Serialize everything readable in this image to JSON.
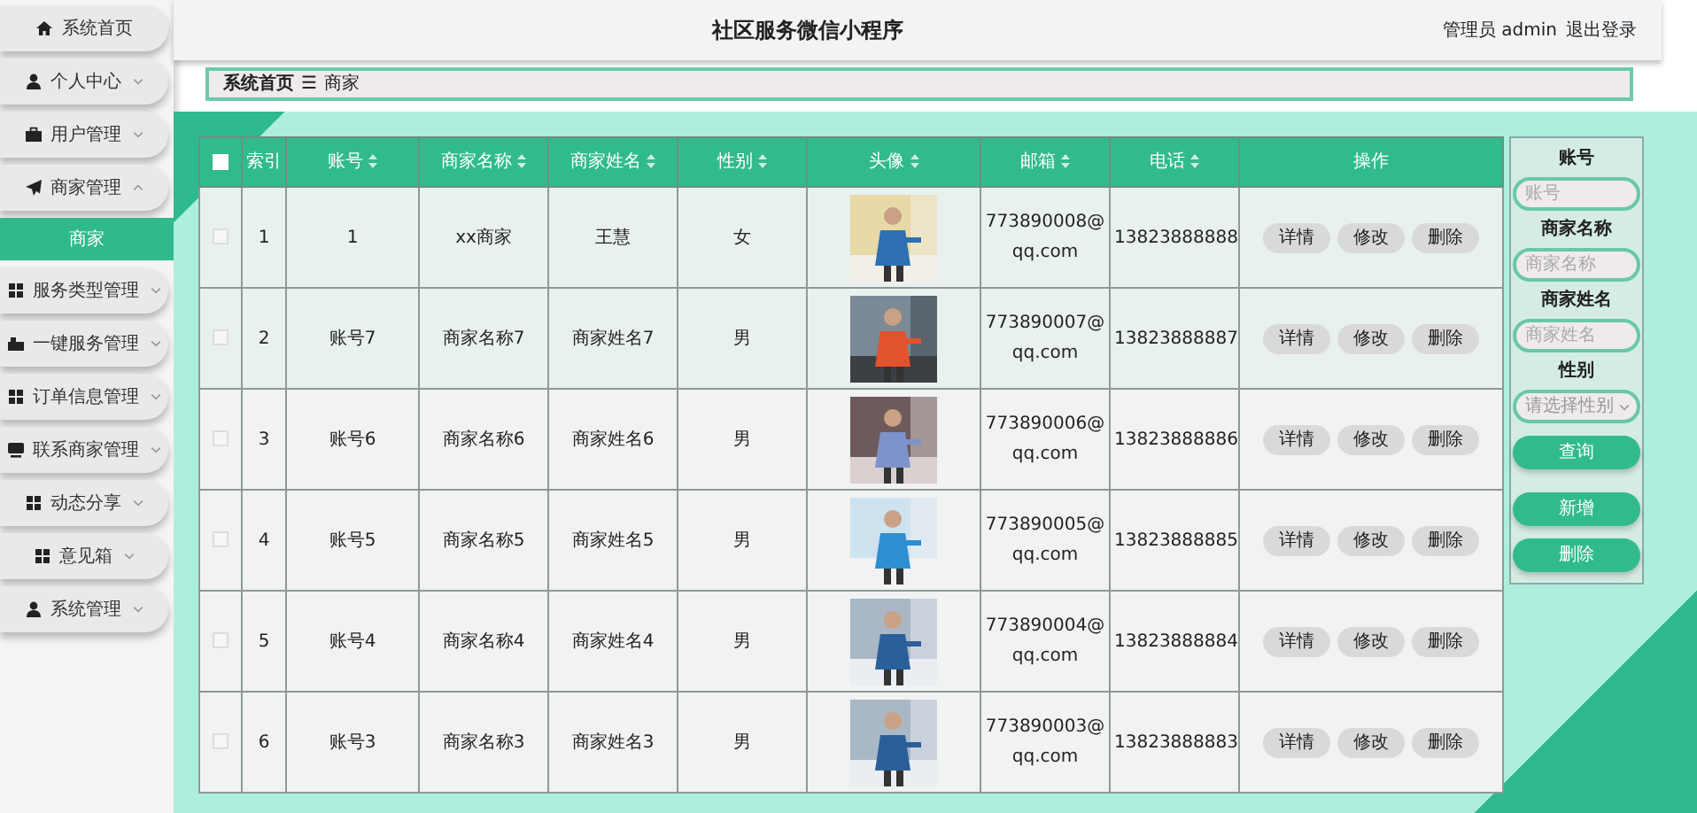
{
  "header": {
    "title": "社区服务微信小程序",
    "user_label": "管理员 admin",
    "logout": "退出登录"
  },
  "sidebar": {
    "items": [
      {
        "label": "系统首页"
      },
      {
        "label": "个人中心",
        "expanded": false
      },
      {
        "label": "用户管理",
        "expanded": false
      },
      {
        "label": "商家管理",
        "expanded": true,
        "children": [
          {
            "label": "商家",
            "selected": true
          }
        ]
      },
      {
        "label": "服务类型管理",
        "expanded": false
      },
      {
        "label": "一键服务管理",
        "expanded": false
      },
      {
        "label": "订单信息管理",
        "expanded": false
      },
      {
        "label": "联系商家管理",
        "expanded": false
      },
      {
        "label": "动态分享",
        "expanded": false
      },
      {
        "label": "意见箱",
        "expanded": false
      },
      {
        "label": "系统管理",
        "expanded": false
      }
    ]
  },
  "breadcrumb": {
    "items": [
      "系统首页",
      "商家"
    ],
    "separator": "☰"
  },
  "table": {
    "select_all": {
      "checked": false
    },
    "columns": [
      {
        "label": "索引",
        "sortable": false
      },
      {
        "label": "账号",
        "sortable": true
      },
      {
        "label": "商家名称",
        "sortable": true
      },
      {
        "label": "商家姓名",
        "sortable": true
      },
      {
        "label": "性别",
        "sortable": true
      },
      {
        "label": "头像",
        "sortable": true
      },
      {
        "label": "邮箱",
        "sortable": true
      },
      {
        "label": "电话",
        "sortable": true
      },
      {
        "label": "操作",
        "sortable": false
      }
    ],
    "rows": [
      {
        "checked": false,
        "index": "1",
        "account": "1",
        "shop_name": "xx商家",
        "owner_name": "王慧",
        "gender": "女",
        "avatar": {
          "kind": "picture"
        },
        "email": "773890008@qq.com",
        "phone": "13823888888",
        "actions": [
          "详情",
          "修改",
          "删除"
        ]
      },
      {
        "checked": false,
        "index": "2",
        "account": "账号7",
        "shop_name": "商家名称7",
        "owner_name": "商家姓名7",
        "gender": "男",
        "avatar": {
          "kind": "picture"
        },
        "email": "773890007@qq.com",
        "phone": "13823888887",
        "actions": [
          "详情",
          "修改",
          "删除"
        ]
      },
      {
        "checked": false,
        "index": "3",
        "account": "账号6",
        "shop_name": "商家名称6",
        "owner_name": "商家姓名6",
        "gender": "男",
        "avatar": {
          "kind": "picture"
        },
        "email": "773890006@qq.com",
        "phone": "13823888886",
        "actions": [
          "详情",
          "修改",
          "删除"
        ]
      },
      {
        "checked": false,
        "index": "4",
        "account": "账号5",
        "shop_name": "商家名称5",
        "owner_name": "商家姓名5",
        "gender": "男",
        "avatar": {
          "kind": "picture"
        },
        "email": "773890005@qq.com",
        "phone": "13823888885",
        "actions": [
          "详情",
          "修改",
          "删除"
        ]
      },
      {
        "checked": false,
        "index": "5",
        "account": "账号4",
        "shop_name": "商家名称4",
        "owner_name": "商家姓名4",
        "gender": "男",
        "avatar": {
          "kind": "picture"
        },
        "email": "773890004@qq.com",
        "phone": "13823888884",
        "actions": [
          "详情",
          "修改",
          "删除"
        ]
      },
      {
        "checked": false,
        "index": "6",
        "account": "账号3",
        "shop_name": "商家名称3",
        "owner_name": "商家姓名3",
        "gender": "男",
        "avatar": {
          "kind": "picture"
        },
        "email": "773890003@qq.com",
        "phone": "13823888883",
        "actions": [
          "详情",
          "修改",
          "删除"
        ]
      }
    ]
  },
  "search": {
    "fields": [
      {
        "label": "账号",
        "placeholder": "账号",
        "kind": "text"
      },
      {
        "label": "商家名称",
        "placeholder": "商家名称",
        "kind": "text"
      },
      {
        "label": "商家姓名",
        "placeholder": "商家姓名",
        "kind": "text"
      },
      {
        "label": "性别",
        "placeholder": "请选择性别",
        "kind": "select"
      }
    ],
    "buttons": [
      "查询",
      "新增",
      "删除"
    ]
  }
}
